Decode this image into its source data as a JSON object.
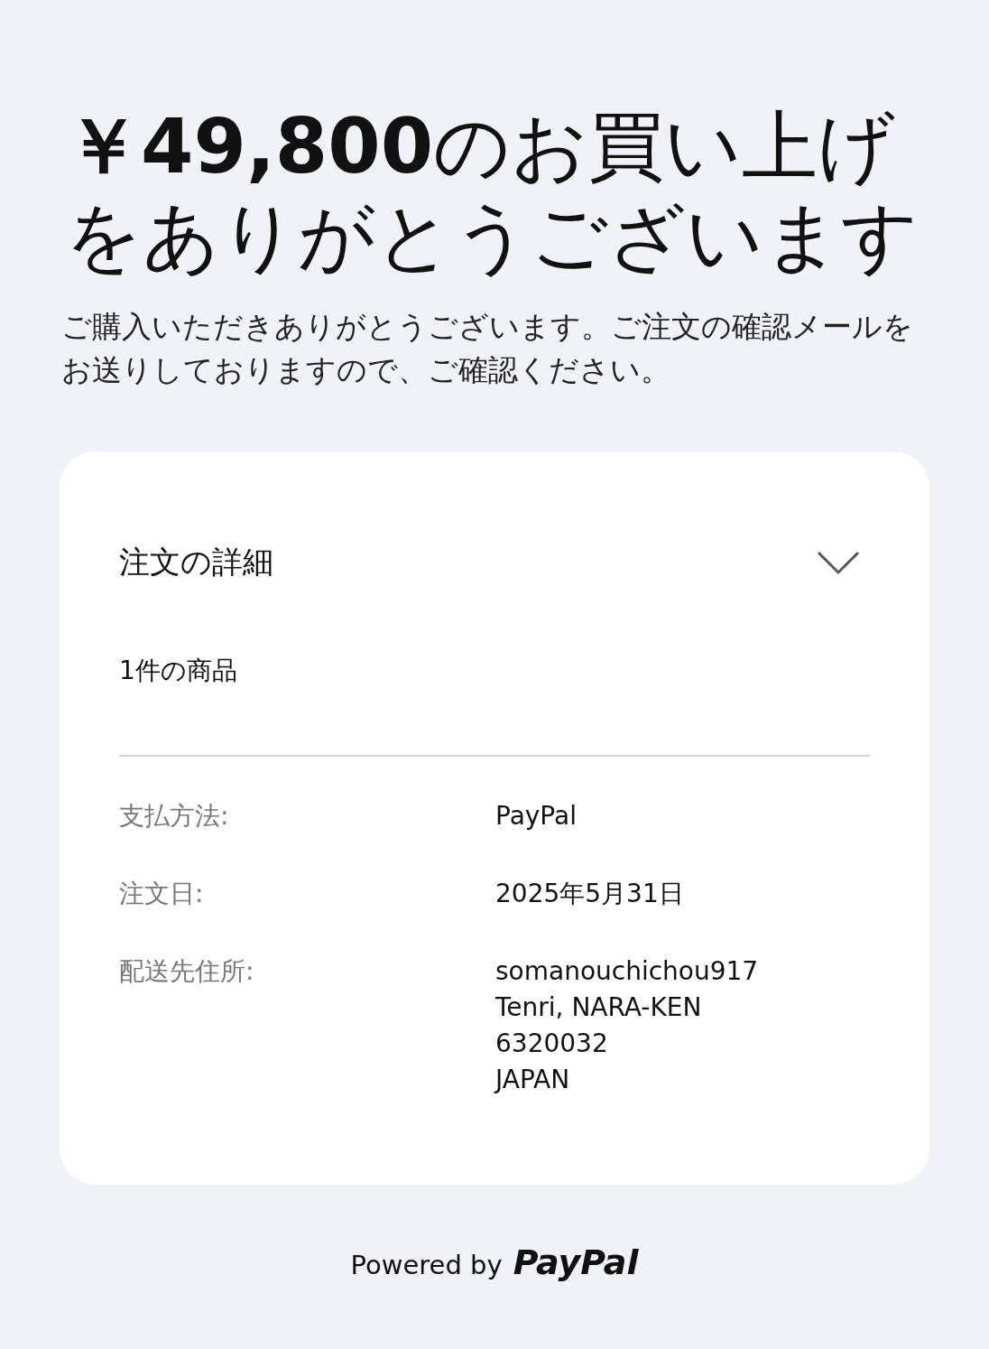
{
  "headline": "**￥49,800**のお買い上げをありがとうございます",
  "message": "ご購入いただきありがとうございます。ご注文の確認メールをお送りしておりますので、ご確認ください。",
  "order_card": {
    "title": "注文の詳細",
    "expanded": false,
    "item_count": "1件の商品",
    "details": [
      {
        "label": "支払方法:",
        "lines": [
          "PayPal"
        ]
      },
      {
        "label": "注文日:",
        "lines": [
          "2025年5月31日"
        ]
      },
      {
        "label": "配送先住所:",
        "lines": [
          "somanouchichou917",
          "Tenri, NARA-KEN",
          "6320032",
          "JAPAN"
        ]
      }
    ]
  },
  "footer": {
    "powered_by": "Powered by",
    "brand": "PayPal"
  }
}
